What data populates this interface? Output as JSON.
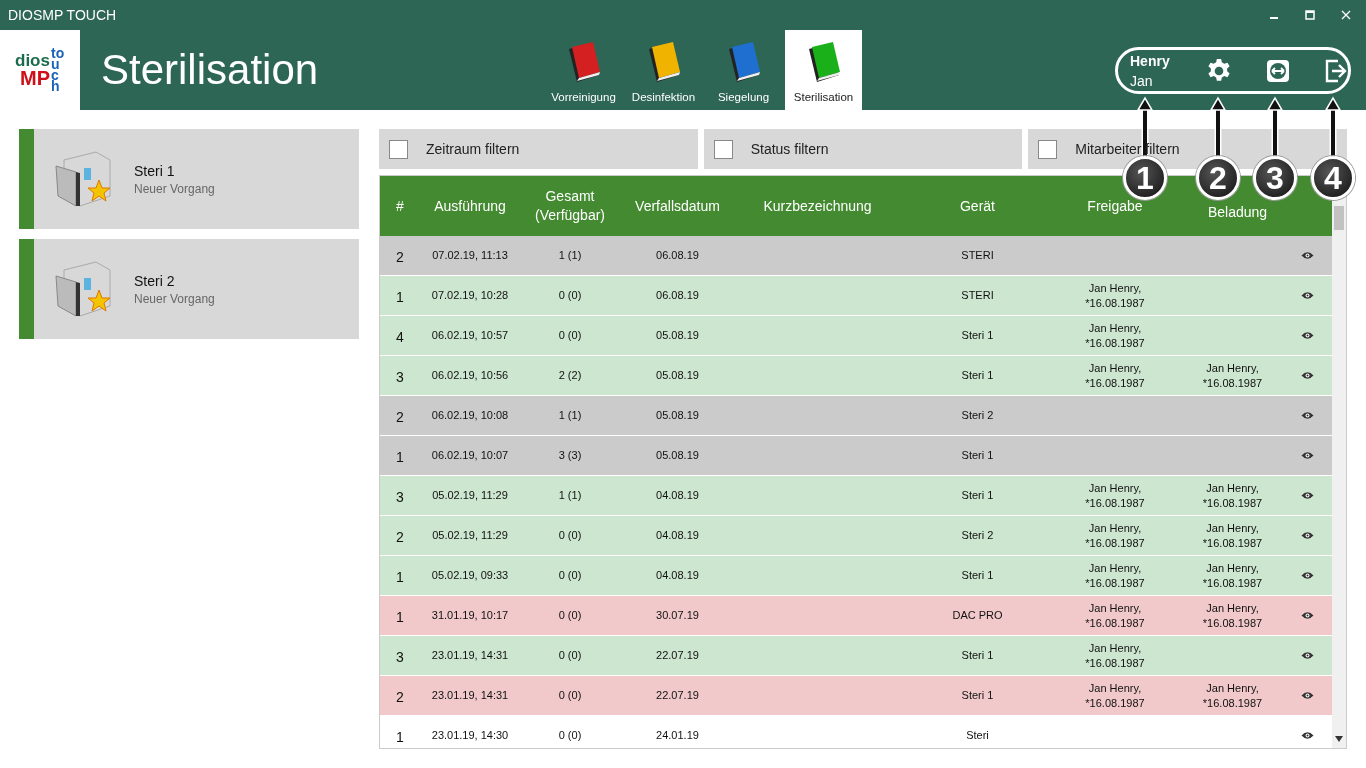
{
  "window": {
    "title": "DIOSMP TOUCH"
  },
  "header": {
    "logo_top": "dios",
    "logo_bottom": "MP",
    "logo_side": "touch",
    "title": "Sterilisation"
  },
  "tabs": [
    {
      "label": "Vorreinigung",
      "color": "#d42020",
      "selected": false
    },
    {
      "label": "Desinfektion",
      "color": "#f0b400",
      "selected": false
    },
    {
      "label": "Siegelung",
      "color": "#1e6fd0",
      "selected": false
    },
    {
      "label": "Sterilisation",
      "color": "#1ab01a",
      "selected": true
    }
  ],
  "user": {
    "last_name": "Henry",
    "first_name": "Jan"
  },
  "devices": [
    {
      "name": "Steri 1",
      "status": "Neuer Vorgang"
    },
    {
      "name": "Steri 2",
      "status": "Neuer Vorgang"
    }
  ],
  "filters": [
    {
      "label": "Zeitraum filtern",
      "checked": false
    },
    {
      "label": "Status filtern",
      "checked": false
    },
    {
      "label": "Mitarbeiter filtern",
      "checked": false
    }
  ],
  "table": {
    "columns": [
      "#",
      "Ausführung",
      "Gesamt (Verfügbar)",
      "Verfallsdatum",
      "Kurzbezeichnung",
      "Gerät",
      "Freigabe",
      "Beladung"
    ],
    "rows": [
      {
        "kind": "open",
        "no": "2",
        "run": "07.02.19, 11:13",
        "total": "1 (1)",
        "expiry": "06.08.19",
        "device": "STERI",
        "release": [],
        "loading": []
      },
      {
        "kind": "released",
        "no": "1",
        "run": "07.02.19, 10:28",
        "total": "0 (0)",
        "expiry": "06.08.19",
        "device": "STERI",
        "release": [
          "Jan Henry,",
          "*16.08.1987"
        ],
        "loading": []
      },
      {
        "kind": "released",
        "no": "4",
        "run": "06.02.19, 10:57",
        "total": "0 (0)",
        "expiry": "05.08.19",
        "device": "Steri 1",
        "release": [
          "Jan Henry,",
          "*16.08.1987"
        ],
        "loading": []
      },
      {
        "kind": "released",
        "no": "3",
        "run": "06.02.19, 10:56",
        "total": "2 (2)",
        "expiry": "05.08.19",
        "device": "Steri 1",
        "release": [
          "Jan Henry,",
          "*16.08.1987"
        ],
        "loading": [
          "Jan Henry,",
          "*16.08.1987"
        ]
      },
      {
        "kind": "open",
        "no": "2",
        "run": "06.02.19, 10:08",
        "total": "1 (1)",
        "expiry": "05.08.19",
        "device": "Steri 2",
        "release": [],
        "loading": []
      },
      {
        "kind": "open",
        "no": "1",
        "run": "06.02.19, 10:07",
        "total": "3 (3)",
        "expiry": "05.08.19",
        "device": "Steri 1",
        "release": [],
        "loading": []
      },
      {
        "kind": "released",
        "no": "3",
        "run": "05.02.19, 11:29",
        "total": "1 (1)",
        "expiry": "04.08.19",
        "device": "Steri 1",
        "release": [
          "Jan Henry,",
          "*16.08.1987"
        ],
        "loading": [
          "Jan Henry,",
          "*16.08.1987"
        ]
      },
      {
        "kind": "released",
        "no": "2",
        "run": "05.02.19, 11:29",
        "total": "0 (0)",
        "expiry": "04.08.19",
        "device": "Steri 2",
        "release": [
          "Jan Henry,",
          "*16.08.1987"
        ],
        "loading": [
          "Jan Henry,",
          "*16.08.1987"
        ]
      },
      {
        "kind": "released",
        "no": "1",
        "run": "05.02.19, 09:33",
        "total": "0 (0)",
        "expiry": "04.08.19",
        "device": "Steri 1",
        "release": [
          "Jan Henry,",
          "*16.08.1987"
        ],
        "loading": [
          "Jan Henry,",
          "*16.08.1987"
        ]
      },
      {
        "kind": "rejected",
        "no": "1",
        "run": "31.01.19, 10:17",
        "total": "0 (0)",
        "expiry": "30.07.19",
        "device": "DAC PRO",
        "release": [
          "Jan Henry,",
          "*16.08.1987"
        ],
        "loading": [
          "Jan Henry,",
          "*16.08.1987"
        ]
      },
      {
        "kind": "released",
        "no": "3",
        "run": "23.01.19, 14:31",
        "total": "0 (0)",
        "expiry": "22.07.19",
        "device": "Steri 1",
        "release": [
          "Jan Henry,",
          "*16.08.1987"
        ],
        "loading": []
      },
      {
        "kind": "rejected",
        "no": "2",
        "run": "23.01.19, 14:31",
        "total": "0 (0)",
        "expiry": "22.07.19",
        "device": "Steri 1",
        "release": [
          "Jan Henry,",
          "*16.08.1987"
        ],
        "loading": [
          "Jan Henry,",
          "*16.08.1987"
        ]
      },
      {
        "kind": "new",
        "no": "1",
        "run": "23.01.19, 14:30",
        "total": "0 (0)",
        "expiry": "24.01.19",
        "device": "Steri",
        "release": [],
        "loading": []
      }
    ]
  },
  "callouts": [
    "1",
    "2",
    "3",
    "4"
  ]
}
